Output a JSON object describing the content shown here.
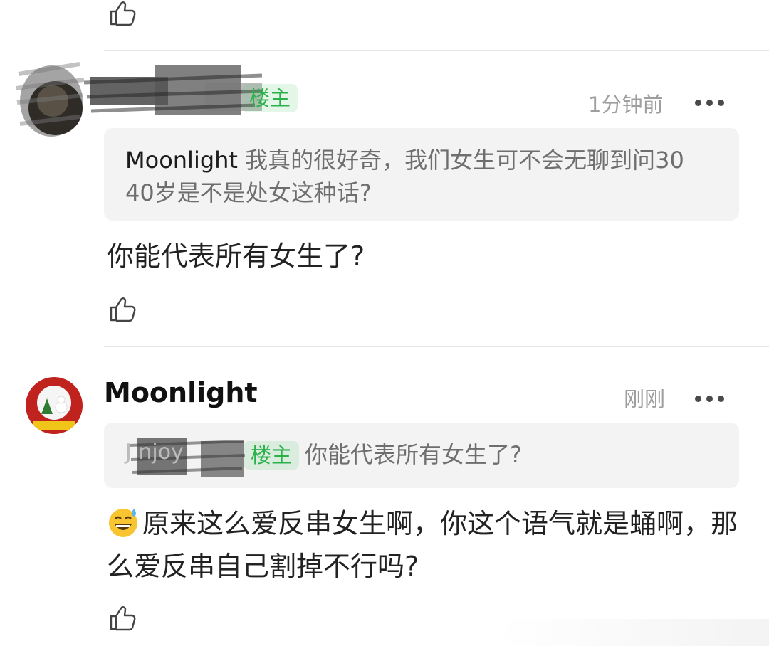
{
  "comments": [
    {
      "author_badge": "楼主",
      "time": "1分钟前",
      "quote": {
        "name": "Moonlight",
        "text": "我真的很好奇，我们女生可不会无聊到问30 40岁是不是处女这种话?"
      },
      "body": "你能代表所有女生了?",
      "icons": [
        "avatar-blurred",
        "more-icon",
        "like-icon"
      ]
    },
    {
      "author": "Moonlight",
      "time": "刚刚",
      "quote": {
        "name_fragment": "J    njoy",
        "badge": "楼主",
        "text": "你能代表所有女生了?"
      },
      "body": "原来这么爱反串女生啊，你这个语气就是蛹啊，那么爱反串自己割掉不行吗?",
      "icons": [
        "sweat-smile-emoji",
        "more-icon",
        "like-icon"
      ]
    }
  ],
  "colors": {
    "badge_green": "#2bb14a",
    "quote_bg": "#f3f3f3",
    "time_gray": "#9e9e9e",
    "divider": "#e6e6e6"
  }
}
